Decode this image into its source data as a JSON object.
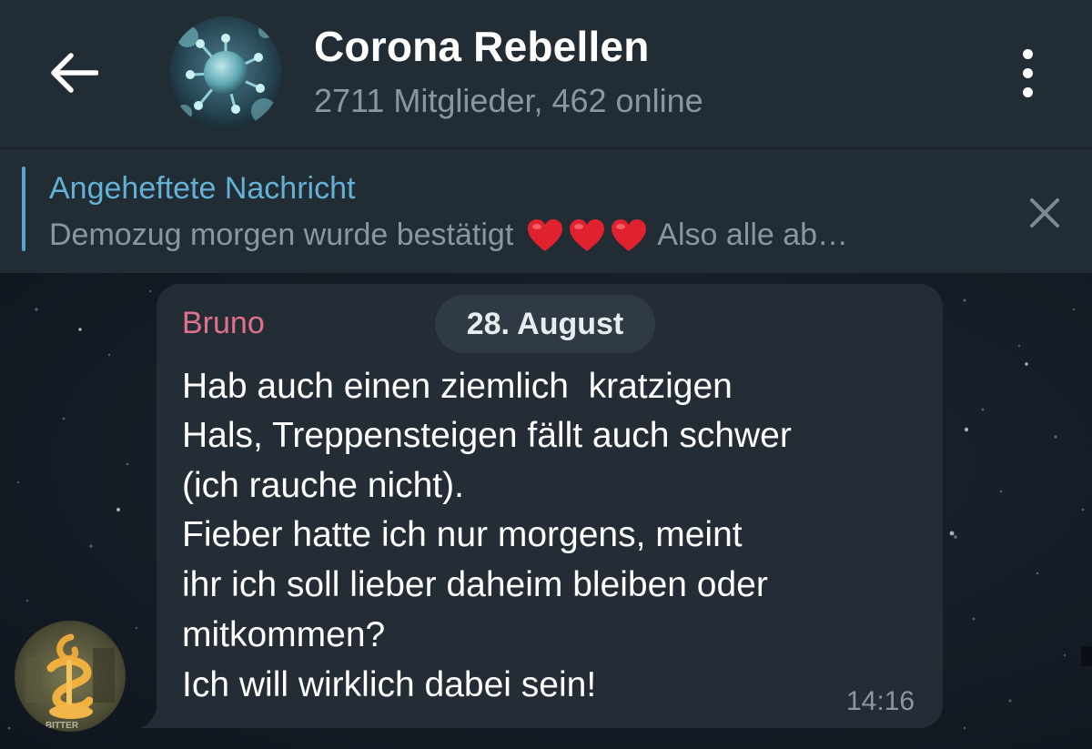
{
  "header": {
    "back_icon": "arrow-left-icon",
    "title": "Corona Rebellen",
    "subtitle": "2711 Mitglieder, 462 online",
    "menu_icon": "more-vertical-icon"
  },
  "pinned": {
    "title": "Angeheftete Nachricht",
    "text_before": "Demozug morgen wurde bestätigt",
    "emoji_icon": "red-heart-icon",
    "emoji_count": 3,
    "text_after": "Also alle ab…",
    "close_icon": "close-icon"
  },
  "message": {
    "sender": "Bruno",
    "date": "28. August",
    "lines": [
      "Hab auch einen ziemlich  kratzigen",
      "Hals, Treppensteigen fällt auch schwer",
      "(ich rauche nicht).",
      "Fieber hatte ich nur morgens, meint",
      "ihr ich soll lieber daheim bleiben oder",
      "mitkommen?",
      "Ich will wirklich dabei sein!"
    ],
    "time": "14:16",
    "avatar_caption": "BITTER"
  },
  "colors": {
    "header_bg": "#222c35",
    "accent_blue": "#63b2d6",
    "sender_pink": "#e0708c",
    "bubble_bg": "#242d36",
    "secondary_text": "#8a96a1",
    "heart_red": "#e0212e"
  }
}
